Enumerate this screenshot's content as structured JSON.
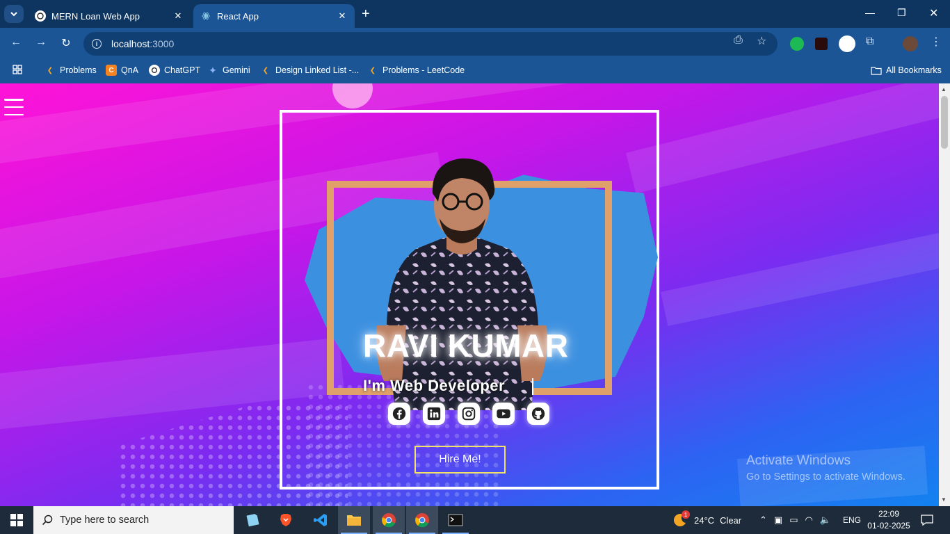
{
  "browser": {
    "tabs": [
      {
        "title": "MERN Loan Web App",
        "active": false
      },
      {
        "title": "React App",
        "active": true
      }
    ],
    "url_host": "localhost",
    "url_port": ":3000",
    "bookmarks": [
      {
        "label": "Problems",
        "icon": "leetcode-icon"
      },
      {
        "label": "QnA",
        "icon": "c-icon"
      },
      {
        "label": "ChatGPT",
        "icon": "chatgpt-icon"
      },
      {
        "label": "Gemini",
        "icon": "gemini-icon"
      },
      {
        "label": "Design Linked List -...",
        "icon": "leetcode-icon"
      },
      {
        "label": "Problems - LeetCode",
        "icon": "leetcode-icon"
      }
    ],
    "all_bookmarks": "All Bookmarks"
  },
  "hero": {
    "name": "RAVI KUMAR",
    "role": "I'm Web Developer",
    "socials": [
      "facebook-icon",
      "linkedin-icon",
      "instagram-icon",
      "youtube-icon",
      "github-icon"
    ],
    "hire_label": "Hire Me!"
  },
  "watermark": {
    "line1": "Activate Windows",
    "line2": "Go to Settings to activate Windows."
  },
  "taskbar": {
    "search_placeholder": "Type here to search",
    "weather_temp": "24°C",
    "weather_desc": "Clear",
    "weather_badge": "1",
    "language": "ENG",
    "time": "22:09",
    "date": "01-02-2025"
  },
  "colors": {
    "bg_pink": "#ff13d7",
    "bg_blue": "#1382f0",
    "hire_border": "#f3e26a",
    "chrome_blue": "#1b5596"
  }
}
